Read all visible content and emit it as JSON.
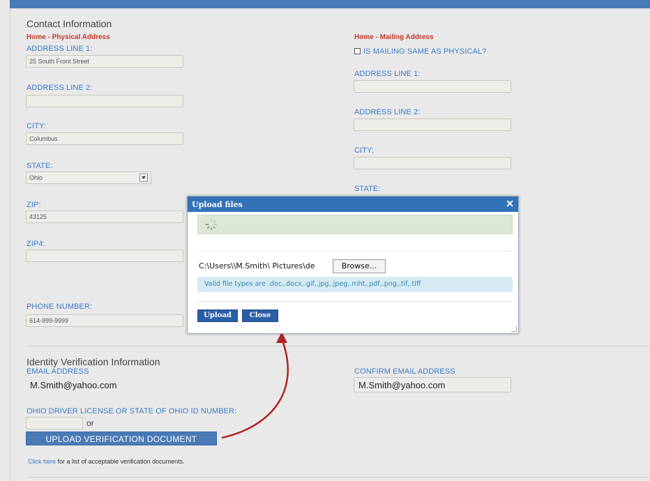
{
  "contact": {
    "section_title": "Contact Information",
    "physical": {
      "heading": "Home - Physical Address",
      "address1_label": "ADDRESS LINE 1:",
      "address1_value": "25 South Front Street",
      "address2_label": "ADDRESS LINE 2:",
      "address2_value": "",
      "city_label": "CITY:",
      "city_value": "Columbus",
      "state_label": "STATE:",
      "state_value": "Ohio",
      "zip_label": "ZIP:",
      "zip_value": "43125",
      "zip4_label": "ZIP4:",
      "zip4_value": "",
      "phone_label": "PHONE NUMBER:",
      "phone_value": "614-999-9999"
    },
    "mailing": {
      "heading": "Home - Mailing Address",
      "same_label": "IS MAILING SAME AS PHYSICAL?",
      "address1_label": "ADDRESS LINE 1:",
      "address2_label": "ADDRESS LINE 2:",
      "city_label": "CITY:",
      "state_label": "STATE:"
    }
  },
  "identity": {
    "section_title": "Identity Verification Information",
    "email_label": "EMAIL ADDRESS",
    "email_value": "M.Smith@yahoo.com",
    "confirm_email_label": "CONFIRM EMAIL ADDRESS",
    "confirm_email_value": "M.Smith@yahoo.com",
    "license_label": "OHIO DRIVER LICENSE OR STATE OF OHIO ID NUMBER:",
    "or_text": "or",
    "upload_button": "UPLOAD VERIFICATION DOCUMENT",
    "footer_link": "Click here",
    "footer_text": "for a list of acceptable verification documents."
  },
  "dialog": {
    "title": "Upload files",
    "close_glyph": "✕",
    "file_path": "C:\\Users\\\\M.Smith\\ Pictures\\de",
    "browse_label": "Browse...",
    "valid_types": "Valid file types are .doc,.docx,.gif,.jpg,.jpeg,.mht,.pdf,.png,.tif,.tiff",
    "upload_label": "Upload",
    "close_label": "Close"
  },
  "colors": {
    "accent": "#3a7bc8",
    "header_bar": "#4a7ab6",
    "label_red": "#c0392b",
    "annotation_arrow": "#b22222"
  },
  "icons": {
    "spinner": "loading-spinner-icon",
    "dropdown": "chevron-down-icon",
    "close": "close-icon"
  }
}
